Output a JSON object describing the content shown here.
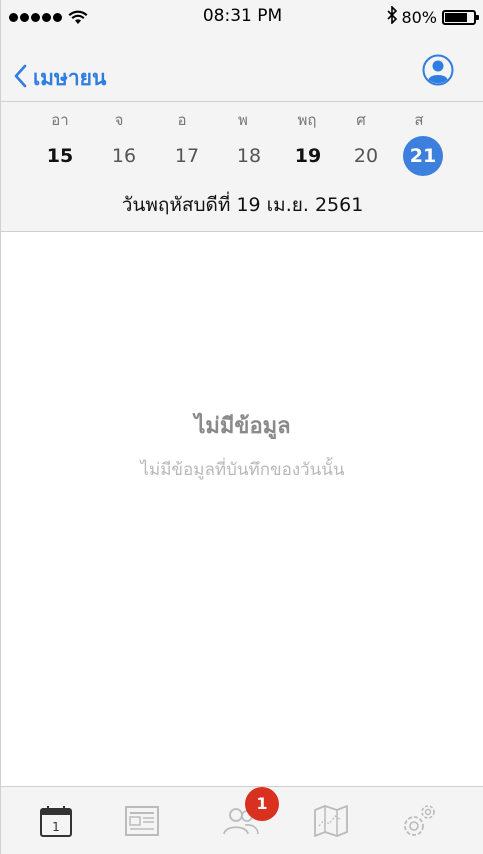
{
  "status_bar": {
    "time": "08:31 PM",
    "battery_text": "80%",
    "battery_level": 0.8
  },
  "nav": {
    "back_label": "เมษายน",
    "back_icon": "chevron-left-icon",
    "profile_icon": "user-circle-icon"
  },
  "week": {
    "days": [
      {
        "weekday": "อา",
        "date": "15",
        "strong": true
      },
      {
        "weekday": "จ",
        "date": "16",
        "strong": false
      },
      {
        "weekday": "อ",
        "date": "17",
        "strong": false
      },
      {
        "weekday": "พ",
        "date": "18",
        "strong": false
      },
      {
        "weekday": "พฤ",
        "date": "19",
        "strong": true
      },
      {
        "weekday": "ศ",
        "date": "20",
        "strong": false
      },
      {
        "weekday": "ส",
        "date": "21",
        "strong": false,
        "selected": true
      }
    ],
    "selected_label": "วันพฤหัสบดีที่ 19 เม.ย. 2561",
    "accent_color": "#3d7fdc"
  },
  "empty_state": {
    "title": "ไม่มีข้อมูล",
    "subtitle": "ไม่มีข้อมูลที่บันทึกของวันนั้น"
  },
  "tab_bar": {
    "tabs": [
      {
        "name": "calendar-icon",
        "icon_text": "1"
      },
      {
        "name": "newspaper-icon"
      },
      {
        "name": "people-icon"
      },
      {
        "name": "map-icon"
      },
      {
        "name": "settings-icon"
      }
    ],
    "badge": "1",
    "badge_color": "#d9301f"
  }
}
